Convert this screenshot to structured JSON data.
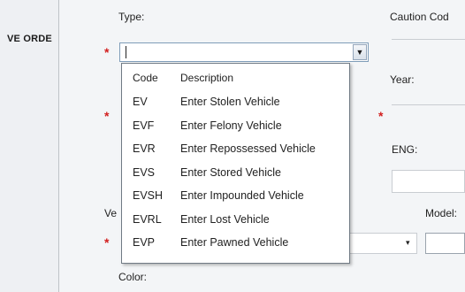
{
  "panel": {
    "title": "VE ORDE"
  },
  "form": {
    "type_label": "Type:",
    "caution_label": "Caution Cod",
    "year_label": "Year:",
    "eng_label": "ENG:",
    "ve_label": "Ve",
    "model_label": "Model:",
    "color_label": "Color:",
    "required_marker": "*",
    "type_value": ""
  },
  "dropdown": {
    "headers": {
      "code": "Code",
      "description": "Description"
    },
    "options": [
      {
        "code": "EV",
        "description": "Enter Stolen Vehicle"
      },
      {
        "code": "EVF",
        "description": "Enter Felony Vehicle"
      },
      {
        "code": "EVR",
        "description": "Enter Repossessed Vehicle"
      },
      {
        "code": "EVS",
        "description": "Enter Stored Vehicle"
      },
      {
        "code": "EVSH",
        "description": "Enter Impounded Vehicle"
      },
      {
        "code": "EVRL",
        "description": "Enter Lost Vehicle"
      },
      {
        "code": "EVP",
        "description": "Enter Pawned Vehicle"
      }
    ]
  },
  "icons": {
    "dropdown_arrow": "▼",
    "small_arrow": "▾"
  }
}
